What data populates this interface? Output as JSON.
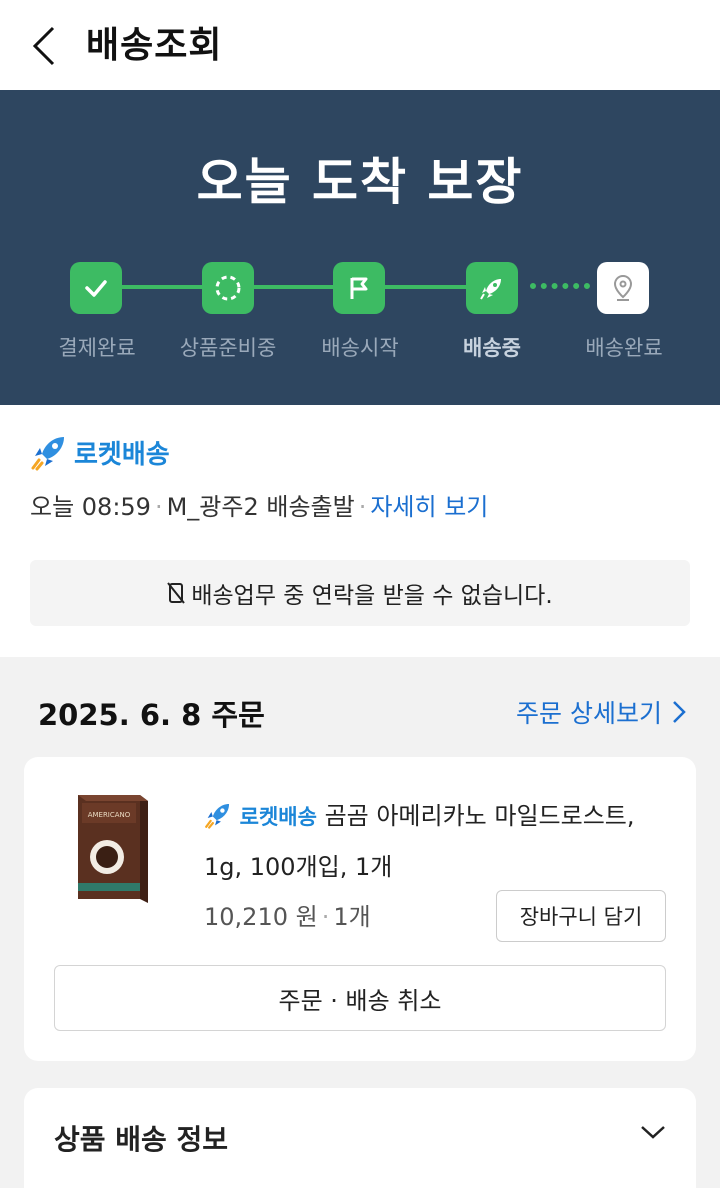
{
  "header": {
    "title": "배송조회"
  },
  "hero": {
    "title": "오늘 도착 보장",
    "steps": [
      {
        "label": "결제완료",
        "icon": "check-icon",
        "state": "done"
      },
      {
        "label": "상품준비중",
        "icon": "circle-progress-icon",
        "state": "done"
      },
      {
        "label": "배송시작",
        "icon": "flag-icon",
        "state": "done"
      },
      {
        "label": "배송중",
        "icon": "rocket-icon",
        "state": "current"
      },
      {
        "label": "배송완료",
        "icon": "location-pin-icon",
        "state": "pending"
      }
    ],
    "colors": {
      "background": "#2e4660",
      "accent": "#3dbb63"
    }
  },
  "status": {
    "badge": "로켓배송",
    "time": "오늘 08:59",
    "sep": "·",
    "location": "M_광주2 배송출발",
    "detail_link": "자세히 보기",
    "notice": "배송업무 중 연락을 받을 수 없습니다."
  },
  "order": {
    "date": "2025. 6. 8 주문",
    "detail_link": "주문 상세보기",
    "product": {
      "badge": "로켓배송",
      "name": "곰곰 아메리카노 마일드로스트, 1g, 100개입, 1개",
      "price": "10,210 원",
      "sep": "·",
      "quantity": "1개",
      "thumb_label": "AMERICANO"
    },
    "cart_button": "장바구니 담기",
    "cancel_button": "주문 · 배송 취소"
  },
  "shipping_info": {
    "title": "상품 배송 정보"
  }
}
